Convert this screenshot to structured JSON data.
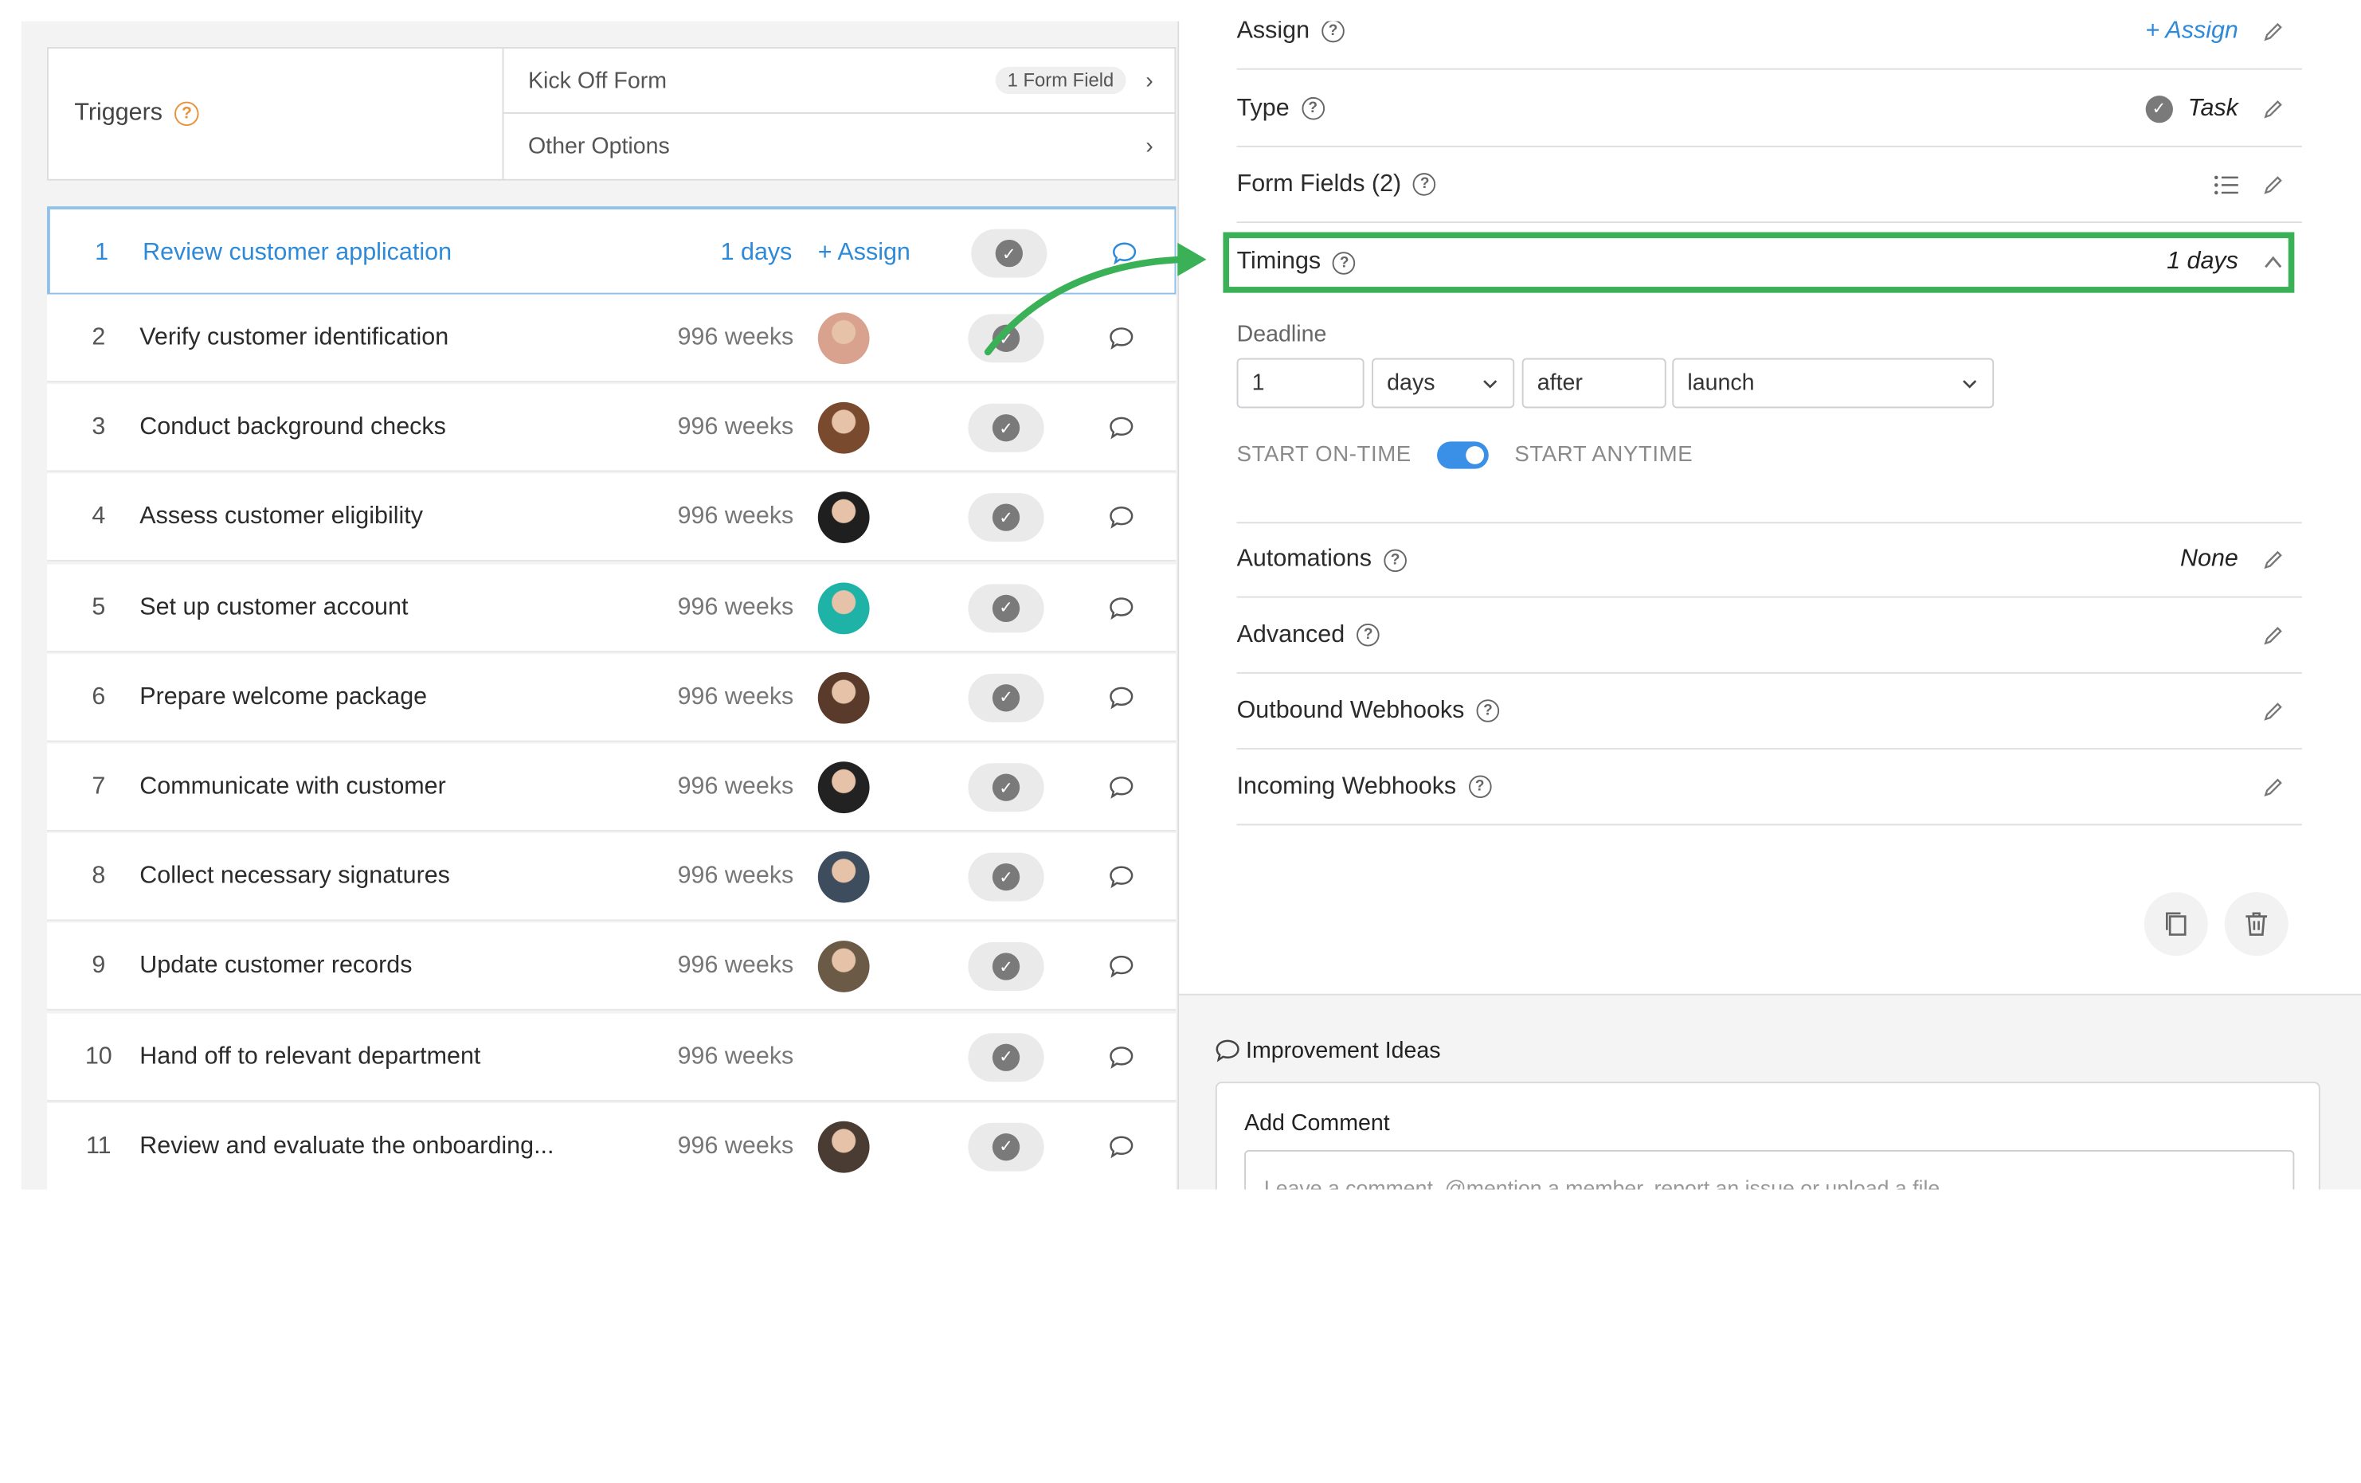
{
  "colors": {
    "accent_blue": "#2e8ad8",
    "highlight_green": "#3bb157",
    "toggle_blue": "#3a8fe6",
    "help_orange": "#e8913a"
  },
  "triggers": {
    "label": "Triggers",
    "kickoff": {
      "label": "Kick Off Form",
      "badge": "1 Form Field"
    },
    "other": {
      "label": "Other Options"
    }
  },
  "tasks": [
    {
      "num": "1",
      "name": "Review customer application",
      "duration": "1 days",
      "assign": "+ Assign",
      "active": true
    },
    {
      "num": "2",
      "name": "Verify customer identification",
      "duration": "996 weeks",
      "avatar": "#d9a28e"
    },
    {
      "num": "3",
      "name": "Conduct background checks",
      "duration": "996 weeks",
      "avatar": "#7a4a2e"
    },
    {
      "num": "4",
      "name": "Assess customer eligibility",
      "duration": "996 weeks",
      "avatar": "#1f1f1f"
    },
    {
      "num": "5",
      "name": "Set up customer account",
      "duration": "996 weeks",
      "avatar": "#1fb3a8"
    },
    {
      "num": "6",
      "name": "Prepare welcome package",
      "duration": "996 weeks",
      "avatar": "#5a3a2a"
    },
    {
      "num": "7",
      "name": "Communicate with customer",
      "duration": "996 weeks",
      "avatar": "#222222"
    },
    {
      "num": "8",
      "name": "Collect necessary signatures",
      "duration": "996 weeks",
      "avatar": "#3d4d5e"
    },
    {
      "num": "9",
      "name": "Update customer records",
      "duration": "996 weeks",
      "avatar": "#6b5a46"
    },
    {
      "num": "10",
      "name": "Hand off to relevant department",
      "duration": "996 weeks"
    },
    {
      "num": "11",
      "name": "Review and evaluate the onboarding...",
      "duration": "996 weeks",
      "avatar": "#4a3b33"
    }
  ],
  "properties": {
    "assign": {
      "label": "Assign",
      "value": "+ Assign"
    },
    "type": {
      "label": "Type",
      "value": "Task"
    },
    "form_fields": {
      "label": "Form Fields (2)"
    },
    "timings": {
      "label": "Timings",
      "value": "1 days"
    },
    "automations": {
      "label": "Automations",
      "value": "None"
    },
    "advanced": {
      "label": "Advanced"
    },
    "outbound": {
      "label": "Outbound Webhooks"
    },
    "incoming": {
      "label": "Incoming Webhooks"
    }
  },
  "deadline": {
    "label": "Deadline",
    "amount": "1",
    "unit": "days",
    "relation": "after",
    "anchor": "launch",
    "start_on_time": "START ON-TIME",
    "start_anytime": "START ANYTIME",
    "toggle_on": true
  },
  "ideas": {
    "title": "Improvement Ideas",
    "add_comment": "Add Comment",
    "placeholder": "Leave a comment, @mention a member, report an issue or upload a file"
  }
}
